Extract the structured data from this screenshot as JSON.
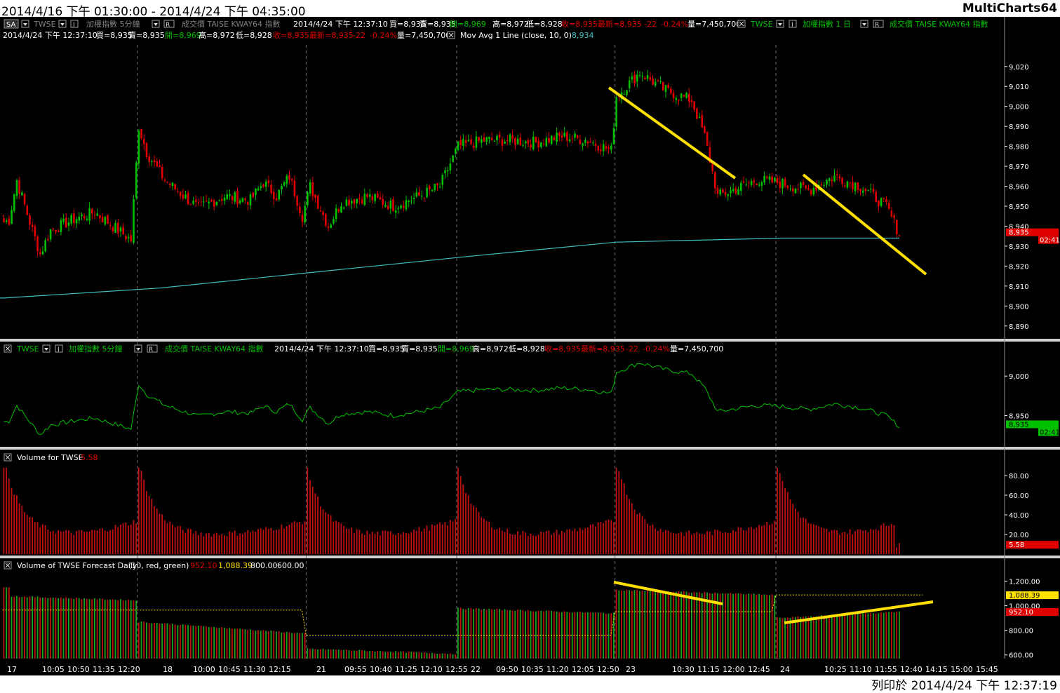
{
  "window": {
    "range_label": "2014/4/16 下午 01:30:00 - 2014/4/24 下午 04:35:00",
    "app_name": "MultiCharts64",
    "printed_at": "列印於 2014/4/24 下午 12:37:19"
  },
  "pane1": {
    "row1": {
      "sa_btn": "SA",
      "sym": "TWSE",
      "i_btn": "I",
      "name": "加權指數 5分鐘",
      "r_btn": "R",
      "tail": "成交價 TAISE KWAY64 指數",
      "date": "2014/4/24 下午 12:37:10",
      "buy": "買=8,935",
      "sell": "賣=8,935",
      "open": "開=8,969",
      "high": "高=8,972",
      "low": "低=8,928",
      "close": "收=8,935",
      "last": "最新=8,935",
      "chg": "-22",
      "pct": "-0.24%",
      "vol": "量=7,450,700",
      "sym2": "TWSE",
      "name2": "加權指數 1 日",
      "tail2": "成交價 TAISE KWAY64 指數"
    },
    "row2": {
      "date": "2014/4/24 下午 12:37:10",
      "buy": "買=8,935",
      "sell": "賣=8,935",
      "open": "開=8,969",
      "high": "高=8,972",
      "low": "低=8,928",
      "close": "收=8,935",
      "last": "最新=8,935",
      "chg": "-22",
      "pct": "-0.24%",
      "vol": "量=7,450,700",
      "ma_label": "Mov Avg 1 Line (close, 10, 0)",
      "ma_value": "8,934"
    },
    "axis_ticks": [
      "9,020",
      "9,010",
      "9,000",
      "8,990",
      "8,980",
      "8,970",
      "8,960",
      "8,950",
      "8,940",
      "8,930",
      "8,920",
      "8,910",
      "8,900",
      "8,890"
    ],
    "price_tag": "8,935",
    "time_tag": "02:41"
  },
  "pane2": {
    "sym": "TWSE",
    "name": "加權指數 5分鐘",
    "tail": "成交價 TAISE KWAY64 指數",
    "date": "2014/4/24 下午 12:37:10",
    "buy": "買=8,935",
    "sell": "賣=8,935",
    "open": "開=8,969",
    "high": "高=8,972",
    "low": "低=8,928",
    "close": "收=8,935",
    "last": "最新=8,935",
    "chg": "-22",
    "pct": "-0.24%",
    "vol": "量=7,450,700",
    "axis_ticks": [
      "9,000",
      "8,950"
    ],
    "price_tag": "8,935",
    "time_tag": "02:41"
  },
  "pane3": {
    "label": "Volume for TWSE",
    "value": "5.58",
    "axis_ticks": [
      "80.00",
      "60.00",
      "40.00",
      "20.00"
    ],
    "tag": "5.58"
  },
  "pane4": {
    "label": "Volume of TWSE Forecast Daily",
    "params": "(10, red, green)",
    "v1": "952.10",
    "v2": "1,088.39",
    "v3": "800.00",
    "v4": "600.00",
    "axis_ticks": [
      "1,200.00",
      "1,000.00",
      "800.00",
      "600.00"
    ],
    "tag_yellow": "1,088.39",
    "tag_red": "952.10"
  },
  "xaxis_labels": [
    "17",
    "10:05",
    "10:50",
    "11:35",
    "12:20",
    "18",
    "10:00",
    "10:45",
    "11:30",
    "12:15",
    "21",
    "09:55",
    "10:40",
    "11:25",
    "12:10",
    "12:55",
    "22",
    "09:50",
    "10:35",
    "11:20",
    "12:05",
    "12:50",
    "23",
    "10:30",
    "11:15",
    "12:00",
    "12:45",
    "24",
    "10:25",
    "11:10",
    "11:55",
    "12:40",
    "14:15",
    "15:00",
    "15:45"
  ],
  "colors": {
    "up": "#00c000",
    "down": "#e00000",
    "ma": "#40c0c0",
    "line": "#00c000",
    "annot": "#ffe000",
    "bg": "#000000"
  },
  "chart_data": [
    {
      "type": "candlestick",
      "title": "TWSE 加權指數 5分鐘",
      "ylim": [
        8885,
        9028
      ],
      "day_breaks": [
        "17",
        "18",
        "21",
        "22",
        "23",
        "24"
      ],
      "close_anchors": [
        [
          0,
          8942
        ],
        [
          2,
          8943
        ],
        [
          5,
          8963
        ],
        [
          10,
          8942
        ],
        [
          14,
          8926
        ],
        [
          18,
          8938
        ],
        [
          28,
          8944
        ],
        [
          35,
          8947
        ],
        [
          45,
          8937
        ],
        [
          49,
          8933
        ],
        [
          52,
          8990
        ],
        [
          55,
          8977
        ],
        [
          62,
          8963
        ],
        [
          75,
          8949
        ],
        [
          85,
          8955
        ],
        [
          95,
          8953
        ],
        [
          100,
          8962
        ],
        [
          105,
          8955
        ],
        [
          110,
          8965
        ],
        [
          115,
          8945
        ],
        [
          118,
          8960
        ],
        [
          125,
          8940
        ],
        [
          130,
          8952
        ],
        [
          140,
          8955
        ],
        [
          150,
          8950
        ],
        [
          160,
          8955
        ],
        [
          168,
          8960
        ],
        [
          175,
          8980
        ],
        [
          185,
          8983
        ],
        [
          195,
          8983
        ],
        [
          205,
          8982
        ],
        [
          215,
          8985
        ],
        [
          225,
          8983
        ],
        [
          234,
          8978
        ],
        [
          236,
          9005
        ],
        [
          245,
          9017
        ],
        [
          255,
          9008
        ],
        [
          265,
          9003
        ],
        [
          270,
          8985
        ],
        [
          275,
          8955
        ],
        [
          290,
          8963
        ],
        [
          298,
          8962
        ],
        [
          310,
          8958
        ],
        [
          320,
          8965
        ],
        [
          330,
          8960
        ],
        [
          340,
          8950
        ],
        [
          345,
          8936
        ]
      ],
      "last_close": 8935
    },
    {
      "type": "line",
      "title": "Mov Avg 1 Line (close, 10, 0)",
      "points": [
        [
          0,
          8904
        ],
        [
          60,
          8909
        ],
        [
          120,
          8917
        ],
        [
          180,
          8925
        ],
        [
          236,
          8932
        ],
        [
          300,
          8934
        ],
        [
          345,
          8934
        ]
      ],
      "last_value": 8934
    },
    {
      "type": "line",
      "title": "TWSE 加權指數 5分鐘 (close line)",
      "ylim": [
        8915,
        9025
      ],
      "last_value": 8935
    },
    {
      "type": "bar",
      "title": "Volume for TWSE",
      "ylim": [
        0,
        90
      ],
      "last_value": 5.58,
      "day_open_peaks": [
        80,
        75,
        68,
        72,
        80,
        77
      ]
    },
    {
      "type": "bar",
      "title": "Volume of TWSE Forecast Daily",
      "ylim": [
        570,
        1260
      ],
      "day_levels": [
        1080,
        870,
        650,
        980,
        1130,
        930
      ],
      "dotted_levels": [
        {
          "day": "17",
          "value": 965
        },
        {
          "day": "18",
          "value": 965
        },
        {
          "day": "21",
          "value": 760
        },
        {
          "day": "22",
          "value": 760
        },
        {
          "day": "23",
          "value": 952.1
        },
        {
          "day": "24",
          "value": 1088.39
        }
      ],
      "values_shown": [
        952.1,
        1088.39,
        800.0,
        600.0
      ]
    }
  ]
}
